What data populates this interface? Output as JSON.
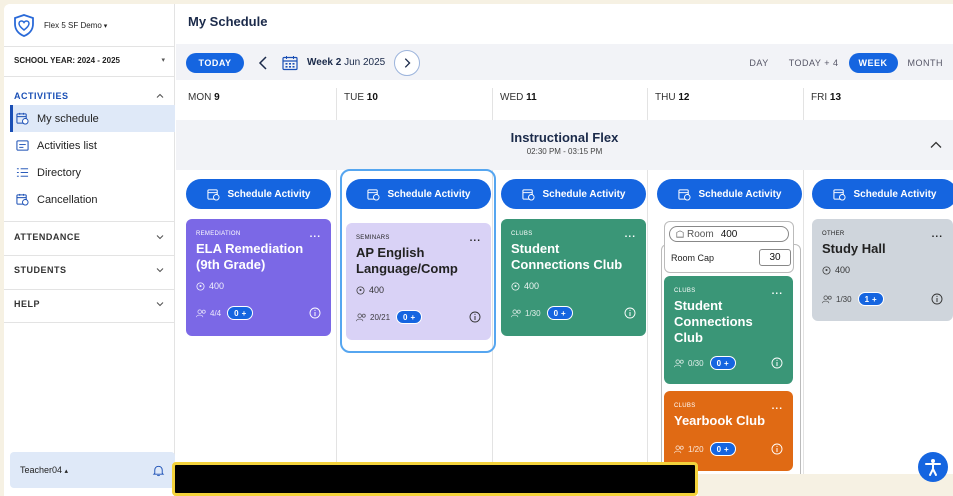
{
  "sidebar": {
    "brand": "Flex 5 SF Demo",
    "school_year": "SCHOOL YEAR: 2024 - 2025",
    "sections": {
      "activities": "ACTIVITIES",
      "attendance": "ATTENDANCE",
      "students": "STUDENTS",
      "help": "HELP"
    },
    "items": [
      {
        "label": "My schedule",
        "icon": "calendar-clock-icon"
      },
      {
        "label": "Activities list",
        "icon": "list-box-icon"
      },
      {
        "label": "Directory",
        "icon": "list-icon"
      },
      {
        "label": "Cancellation",
        "icon": "calendar-clock-icon"
      }
    ],
    "user": "Teacher04"
  },
  "header": {
    "title": "My Schedule"
  },
  "toolbar": {
    "today": "TODAY",
    "week_bold": "Week 2",
    "week_rest": "Jun 2025",
    "views": [
      "DAY",
      "TODAY + 4",
      "WEEK",
      "MONTH"
    ],
    "active_view": "WEEK"
  },
  "days": [
    {
      "name": "MON",
      "num": "9"
    },
    {
      "name": "TUE",
      "num": "10"
    },
    {
      "name": "WED",
      "num": "11"
    },
    {
      "name": "THU",
      "num": "12"
    },
    {
      "name": "FRI",
      "num": "13"
    }
  ],
  "period": {
    "title": "Instructional Flex",
    "time": "02:30 PM - 03:15 PM"
  },
  "schedule_label": "Schedule Activity",
  "cards": {
    "mon": {
      "category": "REMEDIATION",
      "name": "ELA Remediation (9th Grade)",
      "room": "400",
      "count": "4/4",
      "pill": "0",
      "color": "#7b68e6"
    },
    "tue": {
      "category": "SEMINARS",
      "name": "AP English Language/Comp",
      "room": "400",
      "count": "20/21",
      "pill": "0",
      "color": "#d9d2f6"
    },
    "wed": {
      "category": "CLUBS",
      "name": "Student Connections Club",
      "room": "400",
      "count": "1/30",
      "pill": "0",
      "color": "#3a9677"
    },
    "thu1": {
      "category": "CLUBS",
      "name": "Student Connections Club",
      "count": "0/30",
      "pill": "0",
      "color": "#3a9677"
    },
    "thu2": {
      "category": "CLUBS",
      "name": "Yearbook Club",
      "count": "1/20",
      "pill": "0",
      "color": "#e06a14"
    },
    "fri": {
      "category": "OTHER",
      "name": "Study Hall",
      "room": "400",
      "count": "1/30",
      "pill": "1",
      "color": "#cfd5dc"
    }
  },
  "room_filter": {
    "room_label": "Room",
    "room_value": "400",
    "cap_label": "Room Cap",
    "cap_value": "30"
  },
  "pill_symbol": "+",
  "more_symbol": "..."
}
